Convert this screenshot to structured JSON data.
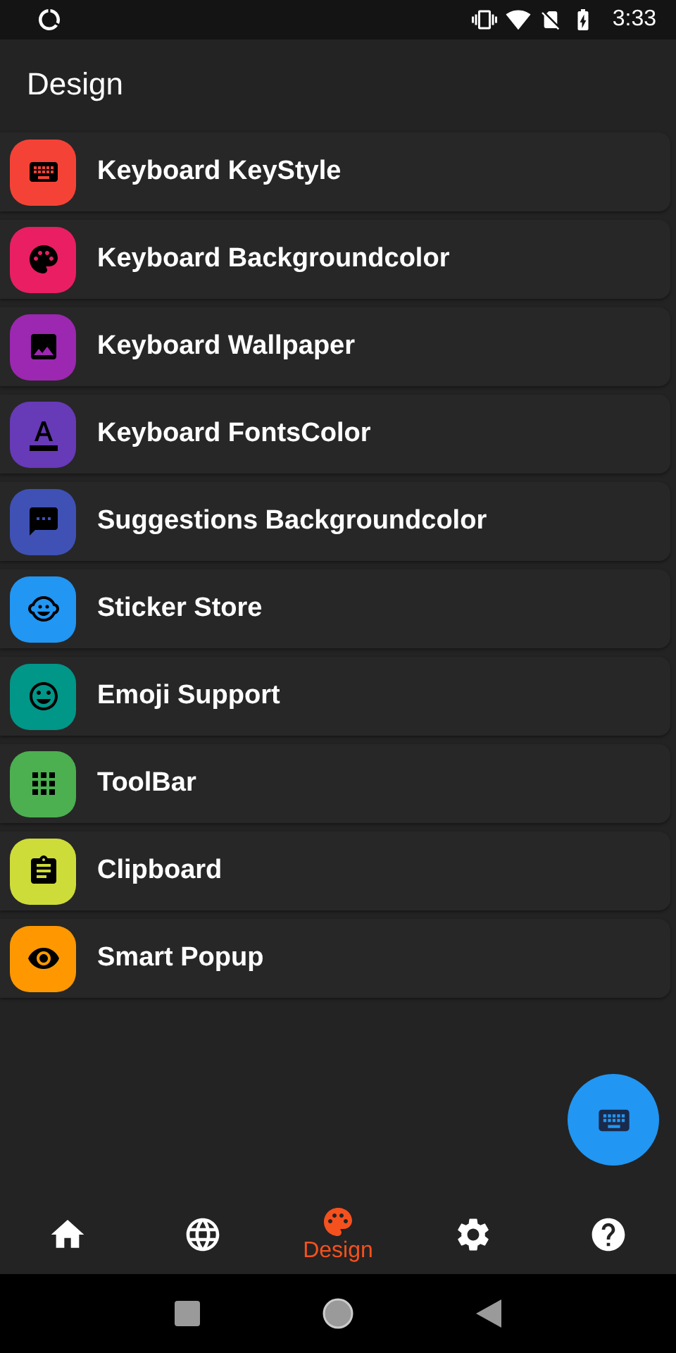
{
  "status_bar": {
    "time": "3:33"
  },
  "header": {
    "title": "Design"
  },
  "items": [
    {
      "label": "Keyboard KeyStyle",
      "color": "#f44336"
    },
    {
      "label": "Keyboard Backgroundcolor",
      "color": "#e91e63"
    },
    {
      "label": "Keyboard Wallpaper",
      "color": "#9c27b0"
    },
    {
      "label": "Keyboard FontsColor",
      "color": "#673ab7"
    },
    {
      "label": "Suggestions Backgroundcolor",
      "color": "#3f51b5"
    },
    {
      "label": "Sticker Store",
      "color": "#2196f3"
    },
    {
      "label": "Emoji Support",
      "color": "#009688"
    },
    {
      "label": "ToolBar",
      "color": "#4caf50"
    },
    {
      "label": "Clipboard",
      "color": "#cddc39"
    },
    {
      "label": "Smart Popup",
      "color": "#ff9800"
    }
  ],
  "bottom_nav": [
    {
      "selected": false
    },
    {
      "selected": false
    },
    {
      "label": "Design",
      "selected": true
    },
    {
      "selected": false
    },
    {
      "selected": false
    }
  ]
}
